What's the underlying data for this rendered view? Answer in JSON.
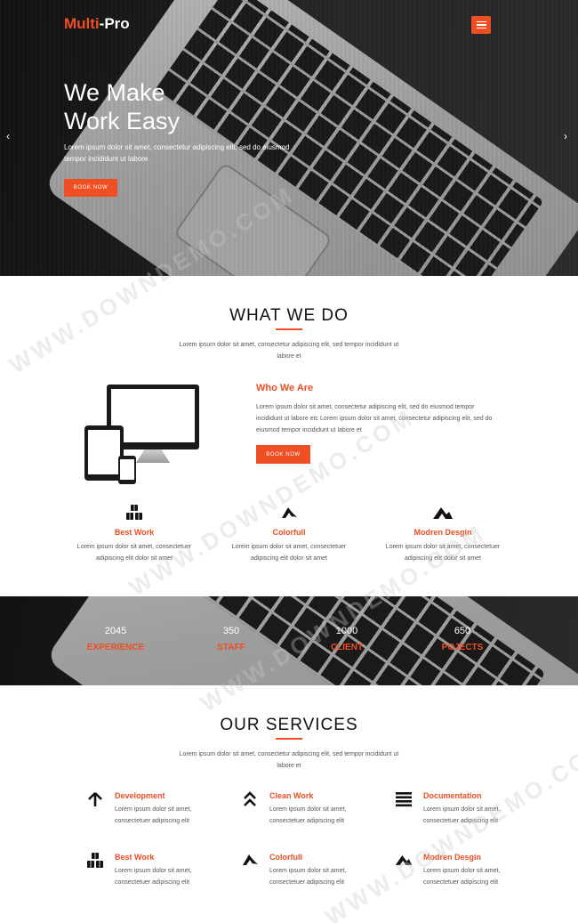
{
  "brand": {
    "part1": "Multi",
    "part2": "-Pro"
  },
  "hero": {
    "title_line1": "We Make",
    "title_line2": "Work Easy",
    "text": "Lorem ipsum dolor sit amet, consectetur adipiscing elit, sed do eiusmod tempor incididunt ut labore",
    "button": "BOOK NOW",
    "prev_arrow": "‹",
    "next_arrow": "›"
  },
  "what_we_do": {
    "title": "WHAT WE DO",
    "intro": "Lorem ipsum dolor sit amet, consectetur adipiscing elit, sed tempor incididunt ut labore et",
    "who_title": "Who We Are",
    "who_text": "Lorem ipsum dolor sit amet, consectetur adipiscing elit, sed do eiusmod tempor incididunt ut labore etc Lorem ipsum dolor sit amet, consectetur adipiscing elit, sed do eiusmod tempor incididunt ut labore et",
    "who_button": "BOOK NOW",
    "features": [
      {
        "icon": "boxes-icon",
        "title": "Best Work",
        "text": "Lorem ipsum dolor sit amet, consectetuer adipiscing elit dolor sit amet"
      },
      {
        "icon": "swoosh-icon",
        "title": "Colorfull",
        "text": "Lorem ipsum dolor sit amet, consectetuer adipiscing elit dolor sit amet"
      },
      {
        "icon": "mountain-icon",
        "title": "Modren Desgin",
        "text": "Lorem ipsum dolor sit amet, consectetuer adipiscing elit dolor sit amet"
      }
    ]
  },
  "stats": [
    {
      "num": "2045",
      "label": "EXPERIENCE"
    },
    {
      "num": "350",
      "label": "STAFF"
    },
    {
      "num": "1000",
      "label": "CLIENT"
    },
    {
      "num": "650",
      "label": "POJECTS"
    }
  ],
  "services": {
    "title": "OUR SERVICES",
    "intro": "Lorem ipsum dolor sit amet, consectetur adipiscing elit, sed tempor incididunt ut labore et",
    "items": [
      {
        "icon": "arrow-up-icon",
        "title": "Development",
        "text": "Lorem ipsum dolor sit amet, consectetuer adipiscing elit"
      },
      {
        "icon": "double-chevron-up-icon",
        "title": "Clean Work",
        "text": "Lorem ipsum dolor sit amet, consectetuer adipiscing elit"
      },
      {
        "icon": "list-icon",
        "title": "Documentation",
        "text": "Lorem ipsum dolor sit amet, consectetuer adipiscing elit"
      },
      {
        "icon": "boxes-icon",
        "title": "Best Work",
        "text": "Lorem ipsum dolor sit amet, consectetuer adipiscing elit"
      },
      {
        "icon": "swoosh-icon",
        "title": "Colorfull",
        "text": "Lorem ipsum dolor sit amet, consectetuer adipiscing elit"
      },
      {
        "icon": "mountain-icon",
        "title": "Modren Desgin",
        "text": "Lorem ipsum dolor sit amet, consectetuer adipiscing elit"
      }
    ]
  },
  "watermark": "WWW.DOWNDEMO.COM",
  "colors": {
    "accent": "#f04e23",
    "dark": "#1b1b1b"
  }
}
